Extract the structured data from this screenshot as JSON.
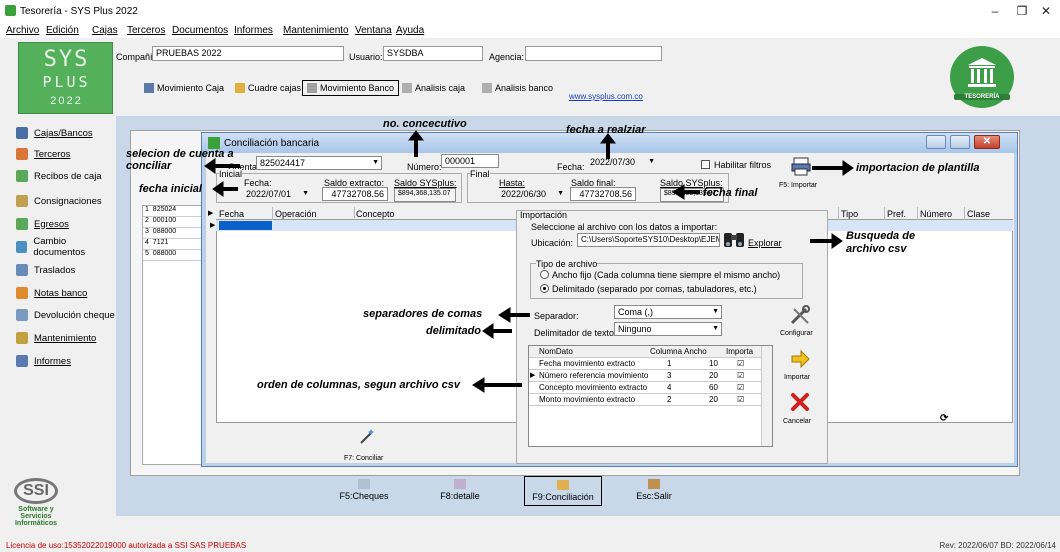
{
  "window": {
    "title": "Tesorería - SYS Plus 2022",
    "controls": {
      "minimize": "–",
      "restore": "❐",
      "close": "✕"
    }
  },
  "menu": [
    "Archivo",
    "Edición",
    "Cajas",
    "Terceros",
    "Documentos",
    "Informes",
    "Mantenimiento",
    "Ventana",
    "Ayuda"
  ],
  "logo": {
    "line1": "SYS",
    "line2": "PLUS",
    "line3": "2022"
  },
  "header": {
    "compania_label": "Compañía:",
    "compania_value": "PRUEBAS 2022",
    "usuario_label": "Usuario:",
    "usuario_value": "SYSDBA",
    "agencia_label": "Agencia:",
    "agencia_value": "",
    "tools": [
      "Movimiento Caja",
      "Cuadre cajas",
      "Movimiento Banco",
      "Analisis caja",
      "Analisis banco"
    ],
    "link": "www.sysplus.com.co",
    "badge": "TESORERÍA"
  },
  "sidebar": [
    {
      "label": "Cajas/Bancos",
      "icon": "cash-register-icon",
      "color": "#4a6fa5"
    },
    {
      "label": "Terceros",
      "icon": "people-icon",
      "color": "#d9763a"
    },
    {
      "label": "Recibos de caja",
      "icon": "receipt-icon",
      "color": "#5aa85a"
    },
    {
      "label": "Consignaciones",
      "icon": "bank-icon",
      "color": "#c0a050"
    },
    {
      "label": "Egresos",
      "icon": "expense-icon",
      "color": "#5aa85a"
    },
    {
      "label": "Cambio documentos",
      "icon": "swap-icon",
      "color": "#4a90c0"
    },
    {
      "label": "Traslados",
      "icon": "transfer-icon",
      "color": "#6a8ab8"
    },
    {
      "label": "Notas banco",
      "icon": "note-icon",
      "color": "#e08a30"
    },
    {
      "label": "Devolución cheque",
      "icon": "cheque-icon",
      "color": "#7a9ac0"
    },
    {
      "label": "Mantenimiento",
      "icon": "gear-icon",
      "color": "#c0a040"
    },
    {
      "label": "Informes",
      "icon": "printer-icon",
      "color": "#5a7ab0"
    }
  ],
  "ssi": {
    "brand": "SSI",
    "line1": "Software y Servicios",
    "line2": "Informáticos"
  },
  "bg_rows": [
    "825024",
    "000100",
    "088000",
    "7121",
    "088000"
  ],
  "bg_row_nums": [
    "1",
    "2",
    "3",
    "4",
    "5"
  ],
  "bottom_buttons": [
    "F5:Cheques",
    "F8:detalle",
    "F9:Conciliación",
    "Esc:Salir"
  ],
  "dialog": {
    "title": "Conciliación bancaria",
    "cuenta_label": "Cuenta:",
    "cuenta_value": "825024417",
    "numero_label": "Número:",
    "numero_value": "000001",
    "fecha_label": "Fecha:",
    "fecha_value": "2022/07/30",
    "habilitar_filtros": "Habilitar filtros",
    "inicial_label": "Inicial",
    "inicial_fecha_label": "Fecha:",
    "inicial_fecha_value": "2022/07/01",
    "saldo_extracto_label": "Saldo extracto:",
    "saldo_extracto_value": "47732708.56",
    "saldo_sysplus_label": "Saldo SYSplus:",
    "saldo_sysplus_value": "$894,368,135.07",
    "final_label": "Final",
    "hasta_label": "Hasta:",
    "hasta_value": "2022/06/30",
    "saldo_final_label": "Saldo final:",
    "saldo_final_value": "47732708.56",
    "saldo_sysplus2_label": "Saldo SYSplus:",
    "saldo_sysplus2_value": "$894,368,135.07",
    "importar_label": "F5: Importar",
    "grid_headers": [
      "Fecha",
      "Operación",
      "Concepto",
      "Tipo",
      "Pref.",
      "Número",
      "Clase"
    ],
    "conciliar_label": "F7: Conciliar"
  },
  "import": {
    "title": "Importación",
    "instruccion": "Seleccione al archivo con los datos a importar:",
    "ubicacion_label": "Ubicación:",
    "ubicacion_value": "C:\\Users\\SoporteSYS10\\Desktop\\EJEMI",
    "explorar": "Explorar",
    "tipo_label": "Tipo de archivo",
    "opt1": "Ancho fijo (Cada columna tiene siempre el mismo ancho)",
    "opt2": "Delimitado (separado por comas, tabuladores, etc.)",
    "separador_label": "Separador:",
    "separador_value": "Coma (,)",
    "delimitador_label": "Delimitador de texto:",
    "delimitador_value": "Ninguno",
    "configurar": "Configurar",
    "importar": "Importar",
    "cancelar": "Cancelar",
    "grid_headers": [
      "NomDato",
      "Columna",
      "Ancho",
      "Importa"
    ],
    "rows": [
      {
        "name": "Fecha movimiento extracto",
        "col": "1",
        "ancho": "10",
        "importa": "☑"
      },
      {
        "name": "Número referencia movimiento",
        "col": "3",
        "ancho": "20",
        "importa": "☑"
      },
      {
        "name": "Concepto movimiento extracto",
        "col": "4",
        "ancho": "60",
        "importa": "☑"
      },
      {
        "name": "Monto movimiento extracto",
        "col": "2",
        "ancho": "20",
        "importa": "☑"
      }
    ]
  },
  "annotations": {
    "no_consecutivo": "no. concecutivo",
    "fecha_realizar": "fecha a realziar",
    "seleccion_cuenta_1": "selecion de cuenta a",
    "seleccion_cuenta_2": "conciliar",
    "importacion_plantilla": "importacion de plantilla",
    "fecha_inicial": "fecha inicial",
    "fecha_final": "fecha final",
    "busqueda_1": "Busqueda de",
    "busqueda_2": "archivo csv",
    "separadores": "separadores de comas",
    "delimitado": "delimitado",
    "orden_columnas": "orden de columnas, segun archivo csv"
  },
  "status": {
    "left": "Licencia de uso:15352022019000 autorizada a SSI SAS PRUEBAS",
    "right": "Rev: 2022/06/07 BD: 2022/06/14"
  }
}
